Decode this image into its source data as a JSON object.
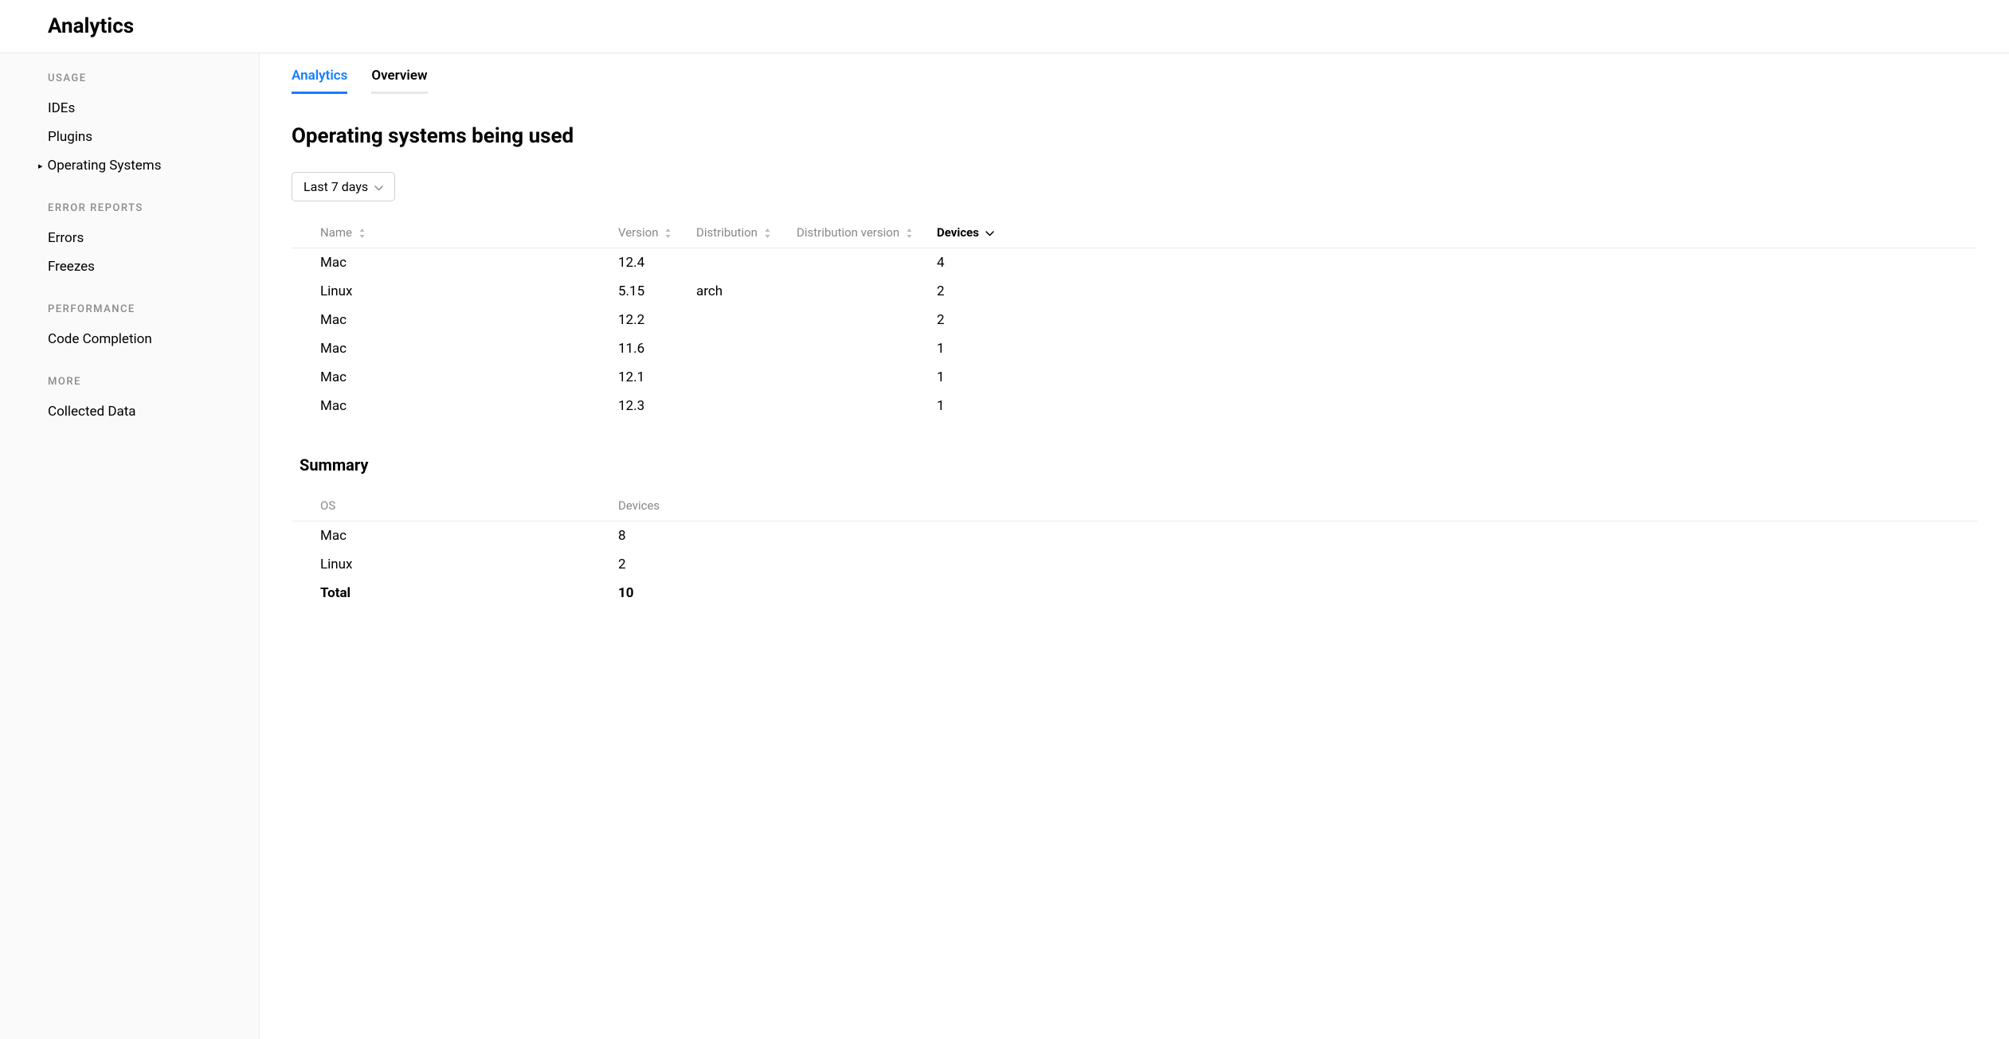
{
  "header": {
    "title": "Analytics"
  },
  "sidebar": {
    "sections": [
      {
        "title": "USAGE",
        "items": [
          {
            "label": "IDEs",
            "active": false
          },
          {
            "label": "Plugins",
            "active": false
          },
          {
            "label": "Operating Systems",
            "active": true
          }
        ]
      },
      {
        "title": "ERROR REPORTS",
        "items": [
          {
            "label": "Errors",
            "active": false
          },
          {
            "label": "Freezes",
            "active": false
          }
        ]
      },
      {
        "title": "PERFORMANCE",
        "items": [
          {
            "label": "Code Completion",
            "active": false
          }
        ]
      },
      {
        "title": "MORE",
        "items": [
          {
            "label": "Collected Data",
            "active": false
          }
        ]
      }
    ]
  },
  "tabs": [
    {
      "label": "Analytics",
      "active": true
    },
    {
      "label": "Overview",
      "active": false
    }
  ],
  "main": {
    "title": "Operating systems being used",
    "date_filter": "Last 7 days",
    "table": {
      "columns": [
        {
          "label": "Name",
          "sortable": true,
          "sorted": false
        },
        {
          "label": "Version",
          "sortable": true,
          "sorted": false
        },
        {
          "label": "Distribution",
          "sortable": true,
          "sorted": false
        },
        {
          "label": "Distribution version",
          "sortable": true,
          "sorted": false
        },
        {
          "label": "Devices",
          "sortable": true,
          "sorted": true,
          "sort_dir": "desc"
        }
      ],
      "rows": [
        {
          "name": "Mac",
          "version": "12.4",
          "distribution": "",
          "dist_version": "",
          "devices": "4"
        },
        {
          "name": "Linux",
          "version": "5.15",
          "distribution": "arch",
          "dist_version": "",
          "devices": "2"
        },
        {
          "name": "Mac",
          "version": "12.2",
          "distribution": "",
          "dist_version": "",
          "devices": "2"
        },
        {
          "name": "Mac",
          "version": "11.6",
          "distribution": "",
          "dist_version": "",
          "devices": "1"
        },
        {
          "name": "Mac",
          "version": "12.1",
          "distribution": "",
          "dist_version": "",
          "devices": "1"
        },
        {
          "name": "Mac",
          "version": "12.3",
          "distribution": "",
          "dist_version": "",
          "devices": "1"
        }
      ]
    },
    "summary": {
      "title": "Summary",
      "columns": [
        {
          "label": "OS"
        },
        {
          "label": "Devices"
        }
      ],
      "rows": [
        {
          "os": "Mac",
          "devices": "8"
        },
        {
          "os": "Linux",
          "devices": "2"
        }
      ],
      "total": {
        "label": "Total",
        "devices": "10"
      }
    }
  }
}
